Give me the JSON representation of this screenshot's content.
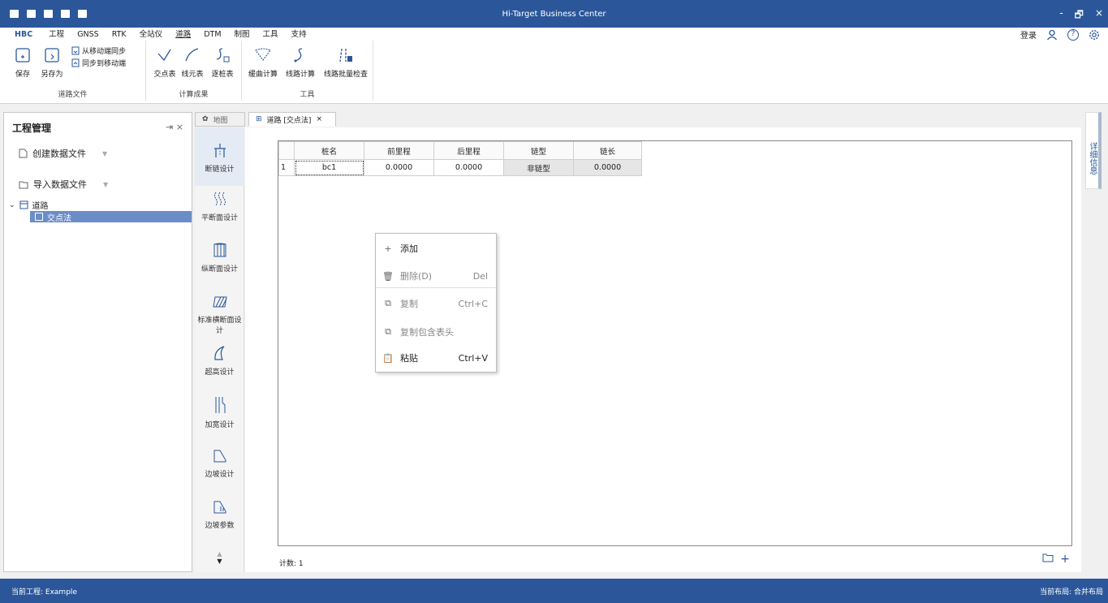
{
  "window": {
    "title": "Hi-Target Business Center",
    "minimize": "-",
    "restore": "🗗",
    "close": "×"
  },
  "ribbon_tabs": {
    "items": [
      "HBC",
      "工程",
      "GNSS",
      "RTK",
      "全站仪",
      "道路",
      "DTM",
      "制图",
      "工具",
      "支持"
    ],
    "active": "道路"
  },
  "account": {
    "login": "登录"
  },
  "ribbon": {
    "road_file": {
      "group": "道路文件",
      "save": "保存",
      "save_as": "另存为",
      "sync_from_mobile": "从移动端同步",
      "sync_to_mobile": "同步到移动端"
    },
    "results": {
      "group": "计算成果",
      "intersection_table": "交点表",
      "element_table": "线元表",
      "station_table": "逐桩表"
    },
    "tools": {
      "group": "工具",
      "curve_calc": "缓曲计算",
      "line_calc": "线路计算",
      "batch_check": "线路批量检查"
    }
  },
  "project_panel": {
    "title": "工程管理",
    "create": "创建数据文件",
    "import": "导入数据文件",
    "tree_root": "道路",
    "tree_child": "交点法"
  },
  "doc_tabs": {
    "map": "地图",
    "road": "道路 [交点法]",
    "close": "×"
  },
  "design_buttons": [
    "断链设计",
    "平断面设计",
    "纵断面设计",
    "标准横断面设计",
    "超高设计",
    "加宽设计",
    "边坡设计",
    "边坡参数"
  ],
  "grid": {
    "headers": [
      "桩名",
      "前里程",
      "后里程",
      "链型",
      "链长"
    ],
    "rows": [
      {
        "index": "1",
        "cells": [
          "bc1",
          "0.0000",
          "0.0000",
          "非链型",
          "0.0000"
        ]
      }
    ],
    "count_label": "计数: 1"
  },
  "right_panel": {
    "label": "详细信息"
  },
  "context_menu": {
    "add": "添加",
    "delete": "删除(D)",
    "delete_shortcut": "Del",
    "copy": "复制",
    "copy_shortcut": "Ctrl+C",
    "copy_with_header": "复制包含表头",
    "paste": "粘贴",
    "paste_shortcut": "Ctrl+V"
  },
  "status": {
    "project": "当前工程: Example",
    "layout": "当前布局: 合并布局"
  },
  "colors": {
    "brand": "#2b579a",
    "selection": "#6a8dc8"
  }
}
